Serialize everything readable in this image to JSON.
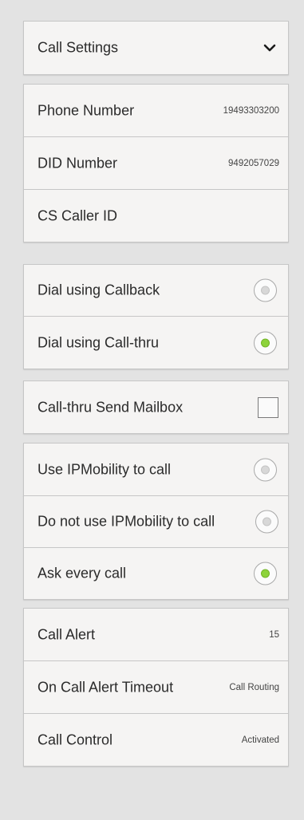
{
  "header": {
    "title": "Call Settings",
    "expand_icon": "chevron-down-icon"
  },
  "numbers": {
    "phone_label": "Phone Number",
    "phone_value": "19493303200",
    "did_label": "DID Number",
    "did_value": "9492057029",
    "caller_id_label": "CS Caller ID"
  },
  "dial_mode": {
    "callback_label": "Dial using Callback",
    "callback_selected": false,
    "callthru_label": "Dial using Call-thru",
    "callthru_selected": true
  },
  "mailbox": {
    "label": "Call-thru Send Mailbox",
    "checked": false
  },
  "ipmobility": {
    "use_label": "Use IPMobility to call",
    "use_selected": false,
    "do_not_use_label": "Do not use IPMobility to call",
    "do_not_use_selected": false,
    "ask_label": "Ask every call",
    "ask_selected": true
  },
  "alerts": {
    "call_alert_label": "Call Alert",
    "call_alert_value": "15",
    "timeout_label": "On Call Alert Timeout",
    "timeout_value": "Call Routing",
    "control_label": "Call Control",
    "control_value": "Activated"
  },
  "colors": {
    "background": "#e3e3e3",
    "card": "#f5f4f3",
    "radio_selected": "#8dd33b"
  }
}
